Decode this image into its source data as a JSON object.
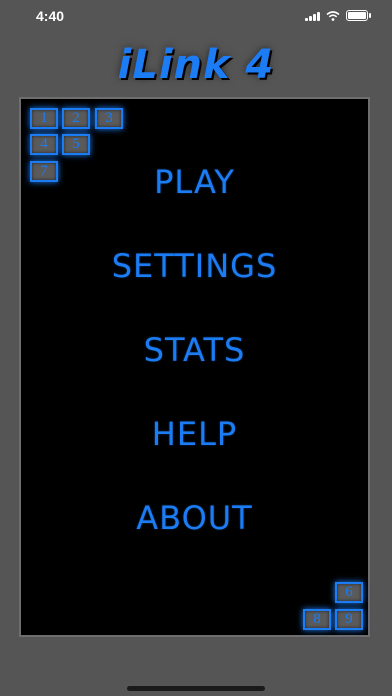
{
  "status_bar": {
    "time": "4:40",
    "icons": [
      "signal-icon",
      "wifi-icon",
      "battery-icon"
    ]
  },
  "app": {
    "title": "iLink 4",
    "accent_color": "#1c7cf4",
    "background_color": "#555555",
    "board_color": "#000000"
  },
  "menu": {
    "items": [
      "PLAY",
      "SETTINGS",
      "STATS",
      "HELP",
      "ABOUT"
    ]
  },
  "tiles": {
    "top_left": [
      "1",
      "2",
      "3",
      "4",
      "5",
      "7"
    ],
    "bottom_right": [
      "6",
      "8",
      "9"
    ]
  }
}
